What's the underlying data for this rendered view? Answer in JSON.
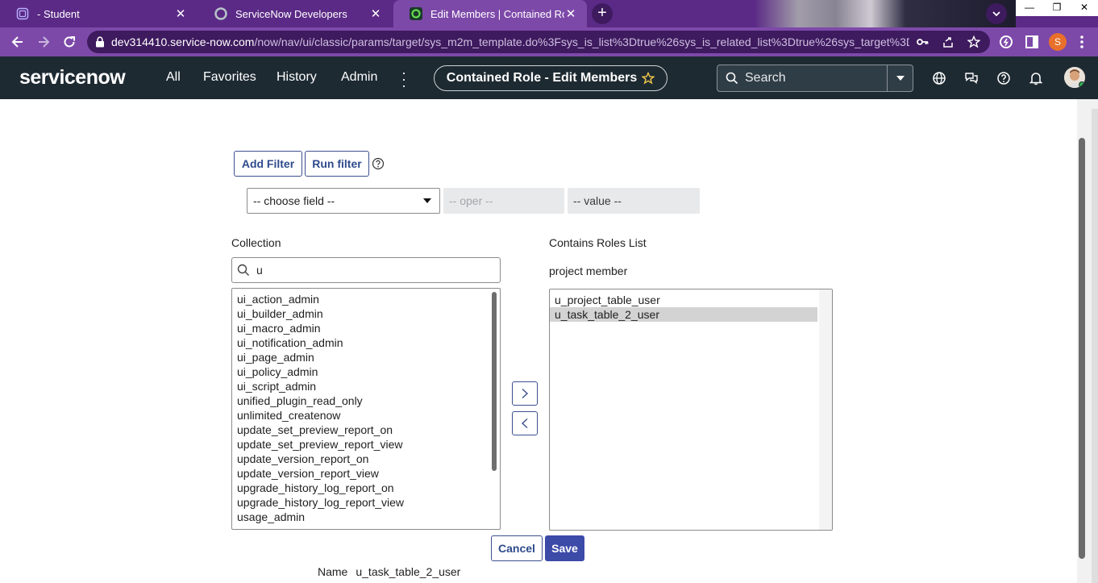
{
  "browser": {
    "tabs": [
      {
        "title": "- Student",
        "active": false
      },
      {
        "title": "ServiceNow Developers",
        "active": false
      },
      {
        "title": "Edit Members | Contained Role |",
        "active": true
      }
    ],
    "new_tab": "+",
    "profile_initial": "S",
    "url_host": "dev314410.service-now.com",
    "url_path": "/now/nav/ui/classic/params/target/sys_m2m_template.do%3Fsys_is_list%3Dtrue%26sys_is_related_list%3Dtrue%26sys_target%3D..."
  },
  "header": {
    "logo": "servicenow",
    "menu": [
      "All",
      "Favorites",
      "History",
      "Admin"
    ],
    "context_title": "Contained Role - Edit Members",
    "search_placeholder": "Search"
  },
  "filter": {
    "add_filter": "Add Filter",
    "run_filter": "Run filter",
    "choose_field": "-- choose field --",
    "oper": "-- oper --",
    "value": "-- value --"
  },
  "collection": {
    "label": "Collection",
    "search_value": "u",
    "items": [
      "ui_action_admin",
      "ui_builder_admin",
      "ui_macro_admin",
      "ui_notification_admin",
      "ui_page_admin",
      "ui_policy_admin",
      "ui_script_admin",
      "unified_plugin_read_only",
      "unlimited_createnow",
      "update_set_preview_report_on",
      "update_set_preview_report_view",
      "update_version_report_on",
      "update_version_report_view",
      "upgrade_history_log_report_on",
      "upgrade_history_log_report_view",
      "usage_admin"
    ]
  },
  "contains": {
    "label": "Contains Roles List",
    "sublabel": "project member",
    "items": [
      "u_project_table_user",
      "u_task_table_2_user"
    ],
    "selected_index": 1
  },
  "actions": {
    "cancel": "Cancel",
    "save": "Save"
  },
  "name_row": {
    "label": "Name",
    "value": "u_task_table_2_user"
  },
  "colors": {
    "tab_strip": "#5b2a86",
    "address_bar": "#7d49a9",
    "header_bg": "#1e2a32",
    "primary_button": "#3c4aa8"
  }
}
